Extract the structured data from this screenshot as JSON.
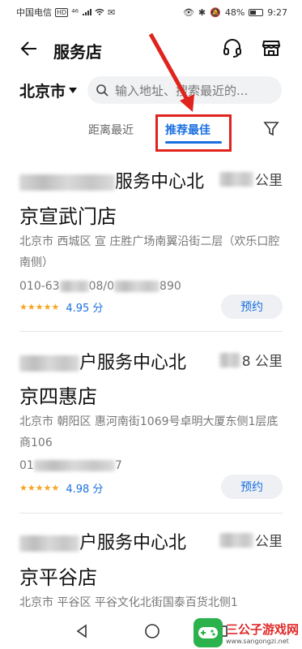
{
  "status_bar": {
    "carrier": "中国电信",
    "hd": "HD",
    "network": "⁴⁶",
    "battery": "48%",
    "battery_level": 0.48,
    "time": "9:27"
  },
  "header": {
    "title": "服务店",
    "icons": [
      "back-arrow-icon",
      "headset-icon",
      "store-icon"
    ]
  },
  "search": {
    "city": "北京市",
    "placeholder": "输入地址、搜索最近的..."
  },
  "tabs": [
    {
      "label": "距离最近",
      "active": false
    },
    {
      "label": "推荐最佳",
      "active": true
    }
  ],
  "stores": [
    {
      "name_line1": "服务中心北",
      "name_line2": "京宣武门店",
      "distance_unit": "公里",
      "address": "北京市 西城区 宣 庄胜广场南翼沿街二层（欢乐口腔南侧）",
      "phone_prefix": "010-63",
      "phone_mid": "08/0",
      "phone_suffix": "890",
      "rating_stars": "★★★★★",
      "rating": "4.95 分",
      "action": "预约"
    },
    {
      "name_line1": "户服务中心北",
      "name_line2": "京四惠店",
      "distance_unit": "8 公里",
      "address": "北京市 朝阳区 惠河南街1069号卓明大厦东侧1层底商106",
      "phone_prefix": "01",
      "phone_mid": "",
      "phone_suffix": "7",
      "rating_stars": "★★★★★",
      "rating": "4.98 分",
      "action": "预约"
    },
    {
      "name_line1": "户服务中心北",
      "name_line2": "京平谷店",
      "distance_unit": "公里",
      "address": "北京市 平谷区 平谷文化北街国泰百货北侧1"
    }
  ],
  "watermark": {
    "title": "三公子游戏网",
    "url": "www.sangongzi.net"
  },
  "colors": {
    "accent": "#1a6fe0",
    "annotation_red": "#e0231c",
    "star": "#f5a623"
  }
}
